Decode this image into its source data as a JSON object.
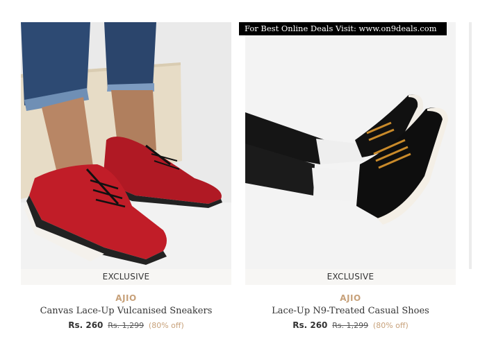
{
  "watermark": {
    "text": "For Best Online Deals Visit:  www.on9deals.com"
  },
  "products": [
    {
      "badge": "EXCLUSIVE",
      "brand": "AJIO",
      "name": "Canvas Lace-Up Vulcanised Sneakers",
      "price": "Rs. 260",
      "mrp": "Rs. 1,299",
      "discount": "(80% off)",
      "image": "red-canvas-sneakers-photo"
    },
    {
      "badge": "EXCLUSIVE",
      "brand": "AJIO",
      "name": "Lace-Up N9-Treated Casual Shoes",
      "price": "Rs. 260",
      "mrp": "Rs. 1,299",
      "discount": "(80% off)",
      "image": "black-casual-shoes-photo"
    }
  ],
  "colors": {
    "brand_accent": "#c7a17a",
    "badge_bg": "#f7f6f4",
    "text": "#333333"
  }
}
